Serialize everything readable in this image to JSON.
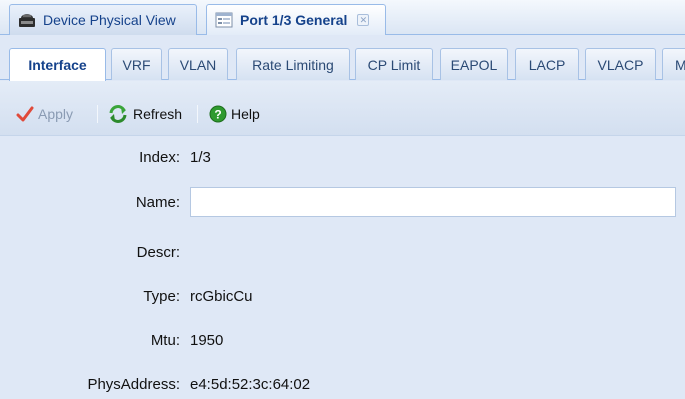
{
  "doc_tabs": [
    {
      "label": "Device Physical View",
      "icon": "device-view-icon",
      "active": false
    },
    {
      "label": "Port 1/3 General",
      "icon": "port-general-icon",
      "active": true,
      "close_glyph": "✕"
    }
  ],
  "sub_tabs": [
    {
      "label": "Interface",
      "active": true
    },
    {
      "label": "VRF"
    },
    {
      "label": "VLAN"
    },
    {
      "label": "Rate Limiting"
    },
    {
      "label": "CP Limit"
    },
    {
      "label": "EAPOL"
    },
    {
      "label": "LACP"
    },
    {
      "label": "VLACP"
    },
    {
      "label": "M"
    }
  ],
  "toolbar": {
    "apply": {
      "label": "Apply",
      "icon": "checkmark-icon",
      "enabled": false
    },
    "refresh": {
      "label": "Refresh",
      "icon": "refresh-icon"
    },
    "help": {
      "label": "Help",
      "icon": "help-icon"
    }
  },
  "form": {
    "index": {
      "label": "Index:",
      "value": "1/3"
    },
    "name": {
      "label": "Name:",
      "value": ""
    },
    "descr": {
      "label": "Descr:",
      "value": ""
    },
    "type": {
      "label": "Type:",
      "value": "rcGbicCu"
    },
    "mtu": {
      "label": "Mtu:",
      "value": "1950"
    },
    "phys_address": {
      "label": "PhysAddress:",
      "value": "e4:5d:52:3c:64:02"
    }
  },
  "colors": {
    "accent": "#15428b",
    "panel_bg": "#dfe8f6",
    "border": "#99bbe8",
    "apply_check": "#e04a3a",
    "refresh_green": "#3aa53a",
    "help_green": "#2f9a2f"
  }
}
